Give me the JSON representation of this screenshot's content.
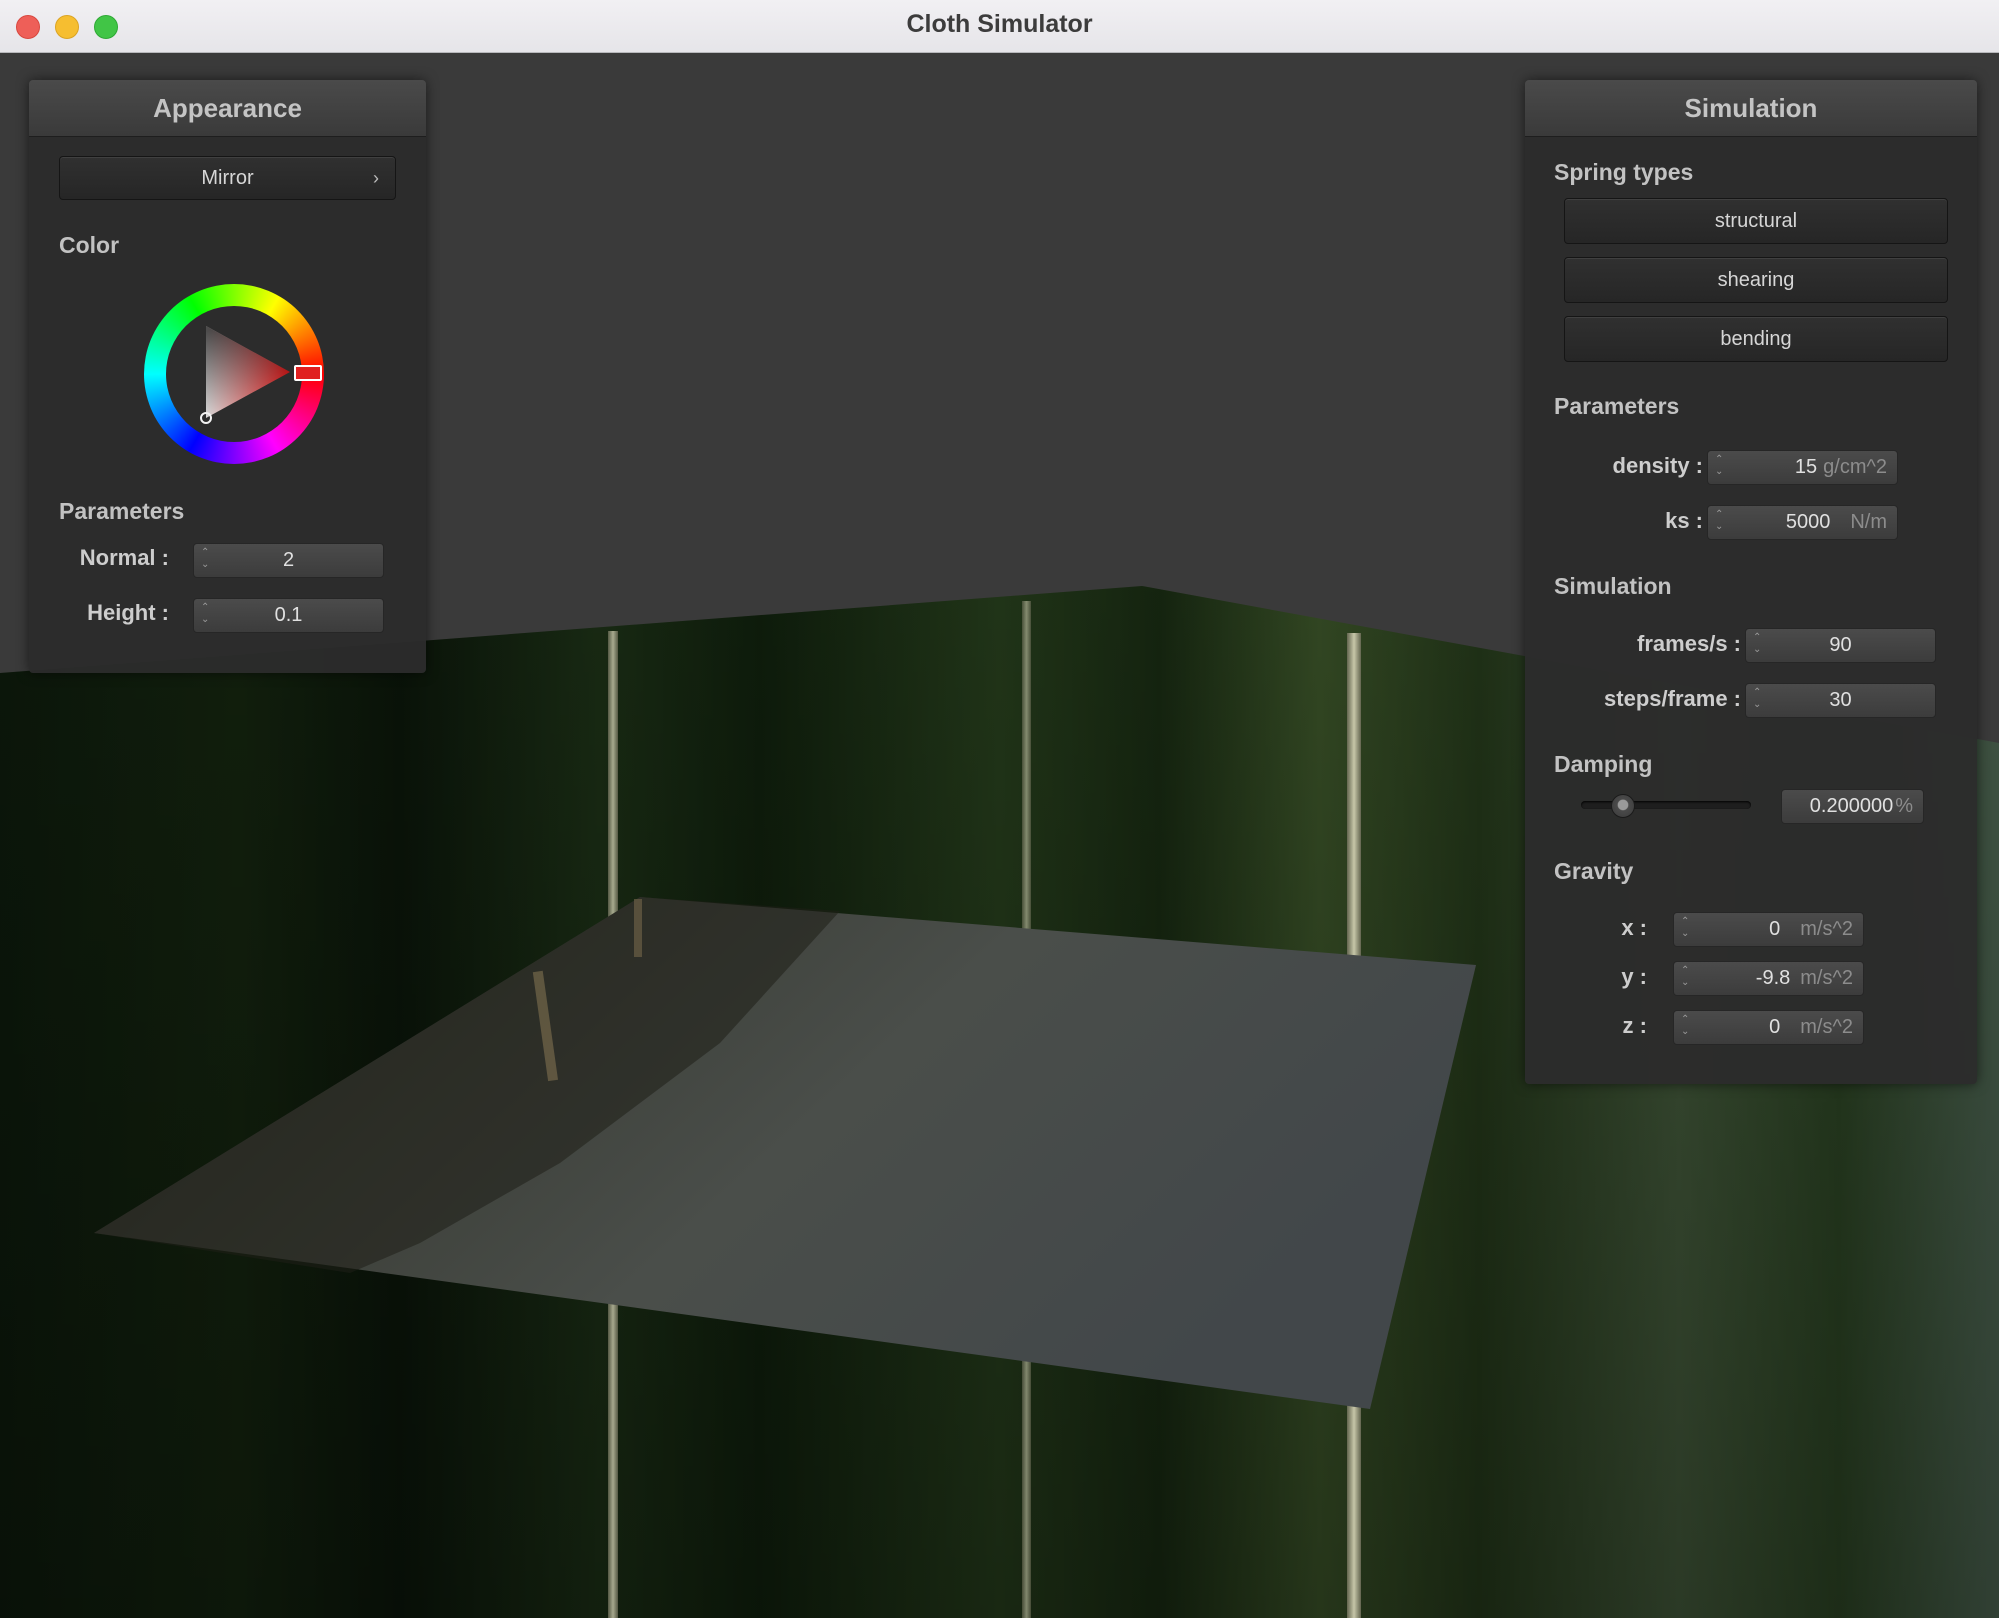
{
  "window": {
    "title": "Cloth Simulator"
  },
  "appearance": {
    "title": "Appearance",
    "shader_button": "Mirror",
    "color_label": "Color",
    "params_label": "Parameters",
    "normal": {
      "label": "Normal :",
      "value": "2"
    },
    "height": {
      "label": "Height :",
      "value": "0.1"
    },
    "selected_color": "#e02020"
  },
  "simulation": {
    "title": "Simulation",
    "spring_types_label": "Spring types",
    "spring_buttons": [
      "structural",
      "shearing",
      "bending"
    ],
    "params_label": "Parameters",
    "density": {
      "label": "density :",
      "value": "15",
      "unit": "g/cm^2"
    },
    "ks": {
      "label": "ks :",
      "value": "5000",
      "unit": "N/m"
    },
    "sim_label": "Simulation",
    "fps": {
      "label": "frames/s :",
      "value": "90"
    },
    "steps": {
      "label": "steps/frame :",
      "value": "30"
    },
    "damping_label": "Damping",
    "damping": {
      "value": "0.200000",
      "unit": "%",
      "fraction": 0.2
    },
    "gravity_label": "Gravity",
    "gravity": [
      {
        "label": "x :",
        "value": "0",
        "unit": "m/s^2"
      },
      {
        "label": "y :",
        "value": "-9.8",
        "unit": "m/s^2"
      },
      {
        "label": "z :",
        "value": "0",
        "unit": "m/s^2"
      }
    ]
  }
}
